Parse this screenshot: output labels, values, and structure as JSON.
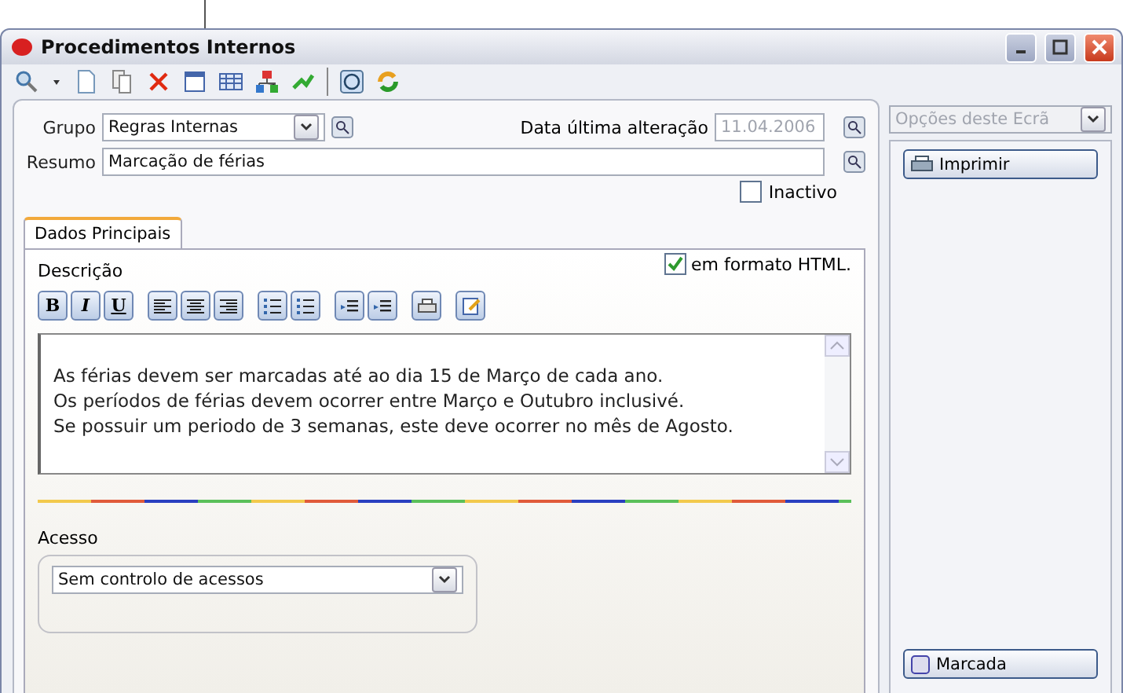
{
  "window": {
    "title": "Procedimentos Internos"
  },
  "form": {
    "grupo_label": "Grupo",
    "grupo_value": "Regras Internas",
    "data_label": "Data última alteração",
    "data_value": "11.04.2006",
    "resumo_label": "Resumo",
    "resumo_value": "Marcação de férias",
    "inactivo": {
      "label": "Inactivo",
      "checked": false
    }
  },
  "tabs": [
    {
      "label": "Dados Principais",
      "selected": true
    }
  ],
  "descricao": {
    "label": "Descrição",
    "html": {
      "label": "em formato HTML.",
      "checked": true
    },
    "format_buttons": [
      "B",
      "I",
      "U"
    ],
    "lines": [
      "As férias devem ser marcadas até ao dia 15 de Março de cada ano.",
      "Os períodos de férias devem ocorrer entre Março e Outubro inclusivé.",
      "Se possuir um periodo de 3 semanas, este deve ocorrer no mês de Agosto."
    ]
  },
  "acesso": {
    "label": "Acesso",
    "value": "Sem controlo de acessos"
  },
  "side": {
    "options_placeholder": "Opções deste Ecrã",
    "print_button": "Imprimir",
    "marcada_button": "Marcada"
  }
}
